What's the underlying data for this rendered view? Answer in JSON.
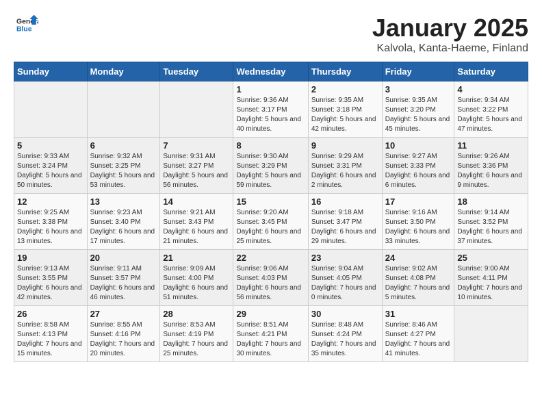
{
  "header": {
    "logo_general": "General",
    "logo_blue": "Blue",
    "title": "January 2025",
    "subtitle": "Kalvola, Kanta-Haeme, Finland"
  },
  "weekdays": [
    "Sunday",
    "Monday",
    "Tuesday",
    "Wednesday",
    "Thursday",
    "Friday",
    "Saturday"
  ],
  "weeks": [
    [
      {
        "day": "",
        "info": ""
      },
      {
        "day": "",
        "info": ""
      },
      {
        "day": "",
        "info": ""
      },
      {
        "day": "1",
        "info": "Sunrise: 9:36 AM\nSunset: 3:17 PM\nDaylight: 5 hours and 40 minutes."
      },
      {
        "day": "2",
        "info": "Sunrise: 9:35 AM\nSunset: 3:18 PM\nDaylight: 5 hours and 42 minutes."
      },
      {
        "day": "3",
        "info": "Sunrise: 9:35 AM\nSunset: 3:20 PM\nDaylight: 5 hours and 45 minutes."
      },
      {
        "day": "4",
        "info": "Sunrise: 9:34 AM\nSunset: 3:22 PM\nDaylight: 5 hours and 47 minutes."
      }
    ],
    [
      {
        "day": "5",
        "info": "Sunrise: 9:33 AM\nSunset: 3:24 PM\nDaylight: 5 hours and 50 minutes."
      },
      {
        "day": "6",
        "info": "Sunrise: 9:32 AM\nSunset: 3:25 PM\nDaylight: 5 hours and 53 minutes."
      },
      {
        "day": "7",
        "info": "Sunrise: 9:31 AM\nSunset: 3:27 PM\nDaylight: 5 hours and 56 minutes."
      },
      {
        "day": "8",
        "info": "Sunrise: 9:30 AM\nSunset: 3:29 PM\nDaylight: 5 hours and 59 minutes."
      },
      {
        "day": "9",
        "info": "Sunrise: 9:29 AM\nSunset: 3:31 PM\nDaylight: 6 hours and 2 minutes."
      },
      {
        "day": "10",
        "info": "Sunrise: 9:27 AM\nSunset: 3:33 PM\nDaylight: 6 hours and 6 minutes."
      },
      {
        "day": "11",
        "info": "Sunrise: 9:26 AM\nSunset: 3:36 PM\nDaylight: 6 hours and 9 minutes."
      }
    ],
    [
      {
        "day": "12",
        "info": "Sunrise: 9:25 AM\nSunset: 3:38 PM\nDaylight: 6 hours and 13 minutes."
      },
      {
        "day": "13",
        "info": "Sunrise: 9:23 AM\nSunset: 3:40 PM\nDaylight: 6 hours and 17 minutes."
      },
      {
        "day": "14",
        "info": "Sunrise: 9:21 AM\nSunset: 3:43 PM\nDaylight: 6 hours and 21 minutes."
      },
      {
        "day": "15",
        "info": "Sunrise: 9:20 AM\nSunset: 3:45 PM\nDaylight: 6 hours and 25 minutes."
      },
      {
        "day": "16",
        "info": "Sunrise: 9:18 AM\nSunset: 3:47 PM\nDaylight: 6 hours and 29 minutes."
      },
      {
        "day": "17",
        "info": "Sunrise: 9:16 AM\nSunset: 3:50 PM\nDaylight: 6 hours and 33 minutes."
      },
      {
        "day": "18",
        "info": "Sunrise: 9:14 AM\nSunset: 3:52 PM\nDaylight: 6 hours and 37 minutes."
      }
    ],
    [
      {
        "day": "19",
        "info": "Sunrise: 9:13 AM\nSunset: 3:55 PM\nDaylight: 6 hours and 42 minutes."
      },
      {
        "day": "20",
        "info": "Sunrise: 9:11 AM\nSunset: 3:57 PM\nDaylight: 6 hours and 46 minutes."
      },
      {
        "day": "21",
        "info": "Sunrise: 9:09 AM\nSunset: 4:00 PM\nDaylight: 6 hours and 51 minutes."
      },
      {
        "day": "22",
        "info": "Sunrise: 9:06 AM\nSunset: 4:03 PM\nDaylight: 6 hours and 56 minutes."
      },
      {
        "day": "23",
        "info": "Sunrise: 9:04 AM\nSunset: 4:05 PM\nDaylight: 7 hours and 0 minutes."
      },
      {
        "day": "24",
        "info": "Sunrise: 9:02 AM\nSunset: 4:08 PM\nDaylight: 7 hours and 5 minutes."
      },
      {
        "day": "25",
        "info": "Sunrise: 9:00 AM\nSunset: 4:11 PM\nDaylight: 7 hours and 10 minutes."
      }
    ],
    [
      {
        "day": "26",
        "info": "Sunrise: 8:58 AM\nSunset: 4:13 PM\nDaylight: 7 hours and 15 minutes."
      },
      {
        "day": "27",
        "info": "Sunrise: 8:55 AM\nSunset: 4:16 PM\nDaylight: 7 hours and 20 minutes."
      },
      {
        "day": "28",
        "info": "Sunrise: 8:53 AM\nSunset: 4:19 PM\nDaylight: 7 hours and 25 minutes."
      },
      {
        "day": "29",
        "info": "Sunrise: 8:51 AM\nSunset: 4:21 PM\nDaylight: 7 hours and 30 minutes."
      },
      {
        "day": "30",
        "info": "Sunrise: 8:48 AM\nSunset: 4:24 PM\nDaylight: 7 hours and 35 minutes."
      },
      {
        "day": "31",
        "info": "Sunrise: 8:46 AM\nSunset: 4:27 PM\nDaylight: 7 hours and 41 minutes."
      },
      {
        "day": "",
        "info": ""
      }
    ]
  ]
}
